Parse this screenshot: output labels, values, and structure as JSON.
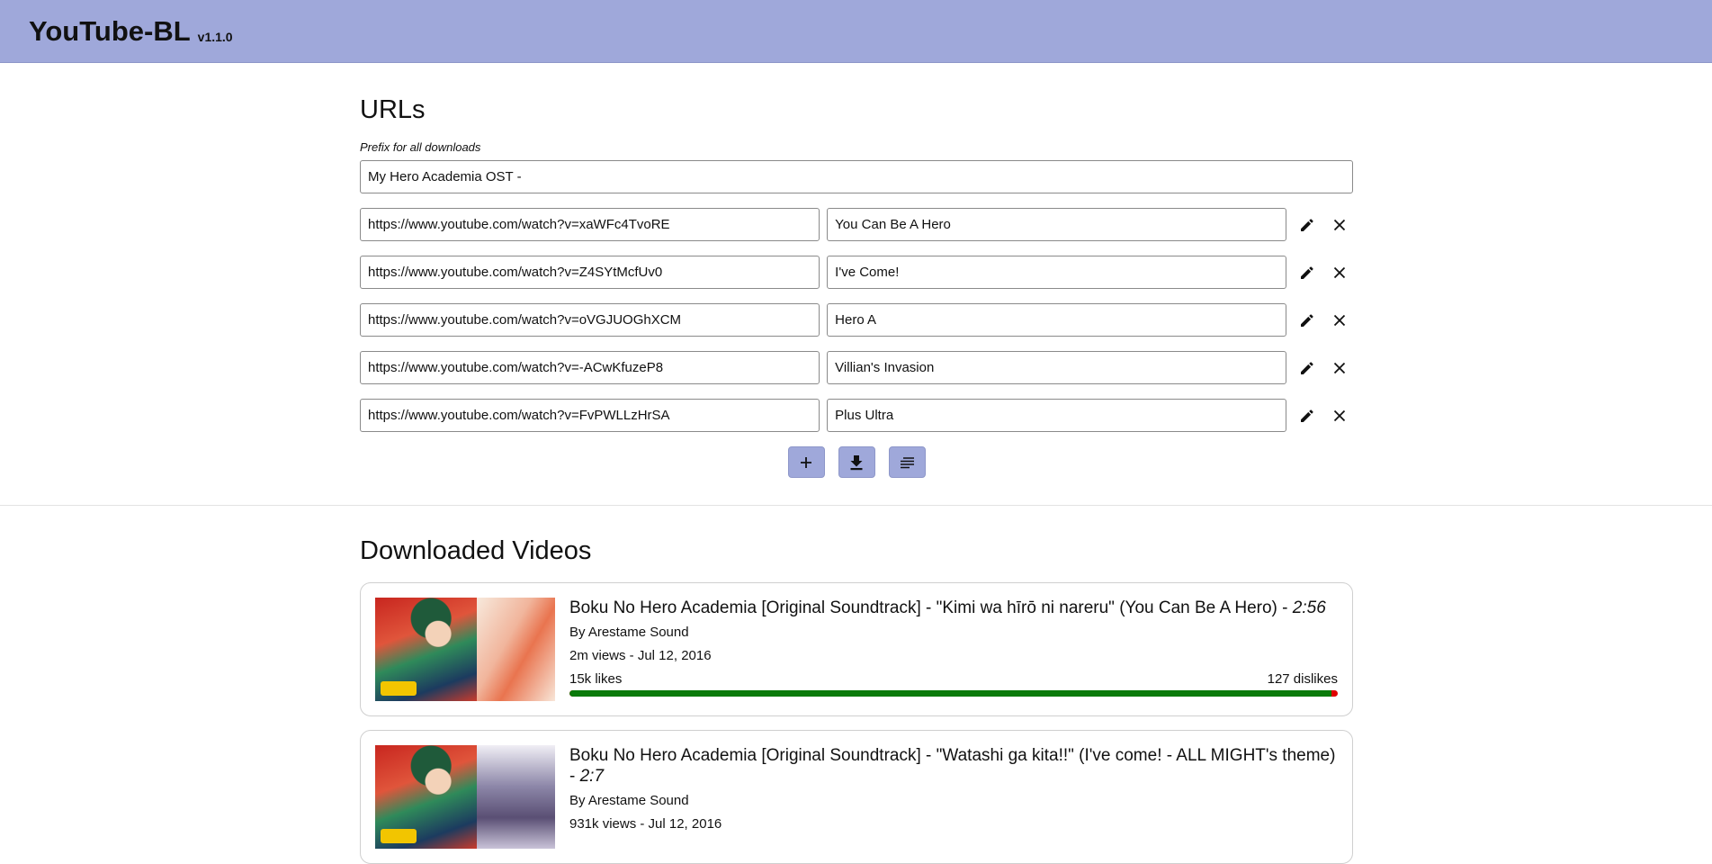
{
  "header": {
    "title": "YouTube-BL",
    "version": "v1.1.0",
    "background": "#9fa8da"
  },
  "urls_section": {
    "title": "URLs",
    "prefix_label": "Prefix for all downloads",
    "prefix_value": "My Hero Academia OST - ",
    "rows": [
      {
        "url": "https://www.youtube.com/watch?v=xaWFc4TvoRE",
        "name": "You Can Be A Hero"
      },
      {
        "url": "https://www.youtube.com/watch?v=Z4SYtMcfUv0",
        "name": "I've Come!"
      },
      {
        "url": "https://www.youtube.com/watch?v=oVGJUOGhXCM",
        "name": "Hero A"
      },
      {
        "url": "https://www.youtube.com/watch?v=-ACwKfuzeP8",
        "name": "Villian's Invasion"
      },
      {
        "url": "https://www.youtube.com/watch?v=FvPWLLzHrSA",
        "name": "Plus Ultra"
      }
    ],
    "row_icons": [
      "pencil-icon",
      "close-icon"
    ],
    "actions": [
      {
        "name": "add-url-button",
        "icon": "plus-icon"
      },
      {
        "name": "download-button",
        "icon": "download-icon"
      },
      {
        "name": "bulk-text-button",
        "icon": "lines-icon"
      }
    ]
  },
  "videos_section": {
    "title": "Downloaded Videos",
    "videos": [
      {
        "title": "Boku No Hero Academia [Original Soundtrack] - \"Kimi wa hīrō ni nareru\" (You Can Be A Hero) - ",
        "duration": "2:56",
        "author": "By Arestame Sound",
        "stats": "2m views - Jul 12, 2016",
        "likes": "15k likes",
        "dislikes": "127 dislikes",
        "like_ratio": 0.992
      },
      {
        "title": "Boku No Hero Academia [Original Soundtrack] - \"Watashi ga kita!!\" (I've come! - ALL MIGHT's theme) - ",
        "duration": "2:7",
        "author": "By Arestame Sound",
        "stats": "931k views - Jul 12, 2016",
        "likes": "",
        "dislikes": "",
        "like_ratio": null
      }
    ]
  },
  "colors": {
    "accent": "#9fa8da",
    "like": "#0a7a0a",
    "dislike": "#e00000"
  }
}
